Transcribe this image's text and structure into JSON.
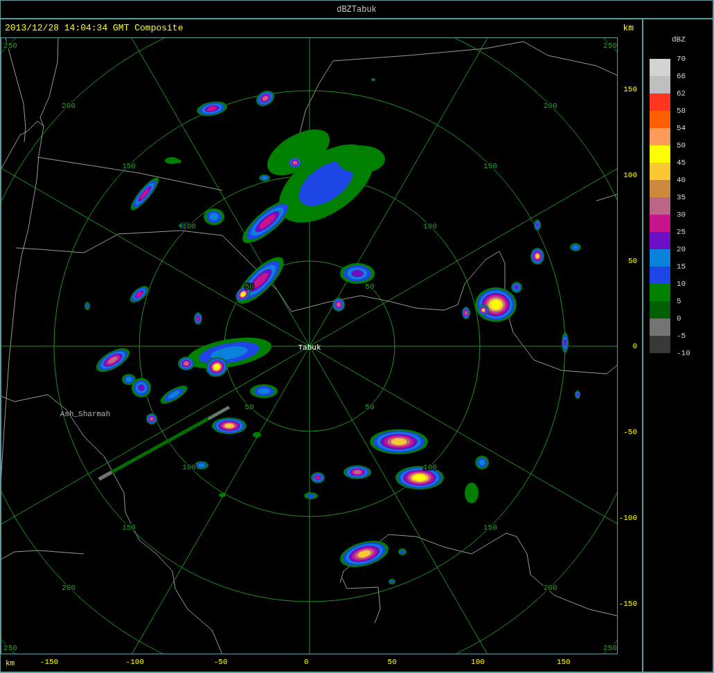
{
  "window": {
    "title": "dBZTabuk"
  },
  "header": {
    "timestamp": "2013/12/28 14:04:34 GMT Composite",
    "unit": "km"
  },
  "map": {
    "rings": [
      {
        "labels": [
          "50",
          "50",
          "50",
          "50"
        ]
      },
      {
        "labels": [
          "100",
          "100",
          "100",
          "100"
        ]
      },
      {
        "labels": [
          "150",
          "150",
          "150",
          "150"
        ]
      },
      {
        "labels": [
          "200",
          "200",
          "200",
          "200"
        ]
      },
      {
        "labels": [
          "250",
          "250",
          "250",
          "250"
        ]
      }
    ],
    "places": [
      {
        "kind": "radar",
        "name": "Tabuk"
      },
      {
        "kind": "town",
        "name": "Ash_Sharmah"
      }
    ]
  },
  "right_axis": {
    "ticks": [
      "150",
      "100",
      "50",
      "0",
      "-50",
      "-100",
      "-150"
    ]
  },
  "bottom_axis": {
    "unit": "km",
    "ticks": [
      "-150",
      "-100",
      "-50",
      "0",
      "50",
      "100",
      "150"
    ]
  },
  "legend": {
    "title": "dBZ",
    "bands": [
      {
        "color": "#d3d3d3"
      },
      {
        "color": "#bebebe"
      },
      {
        "color": "#ff3520"
      },
      {
        "color": "#ff5f00"
      },
      {
        "color": "#ff9b5a"
      },
      {
        "color": "#ffff00"
      },
      {
        "color": "#fac832"
      },
      {
        "color": "#cd8a3c"
      },
      {
        "color": "#bb6688"
      },
      {
        "color": "#c8148c"
      },
      {
        "color": "#6e0fc8"
      },
      {
        "color": "#0a82dc"
      },
      {
        "color": "#1e46e6"
      },
      {
        "color": "#007f00"
      },
      {
        "color": "#005f00"
      },
      {
        "color": "#737373"
      },
      {
        "color": "#373737"
      }
    ],
    "labels": [
      "70",
      "66",
      "62",
      "58",
      "54",
      "50",
      "45",
      "40",
      "35",
      "30",
      "25",
      "20",
      "15",
      "10",
      "5",
      "0",
      "-5",
      "-10"
    ]
  }
}
